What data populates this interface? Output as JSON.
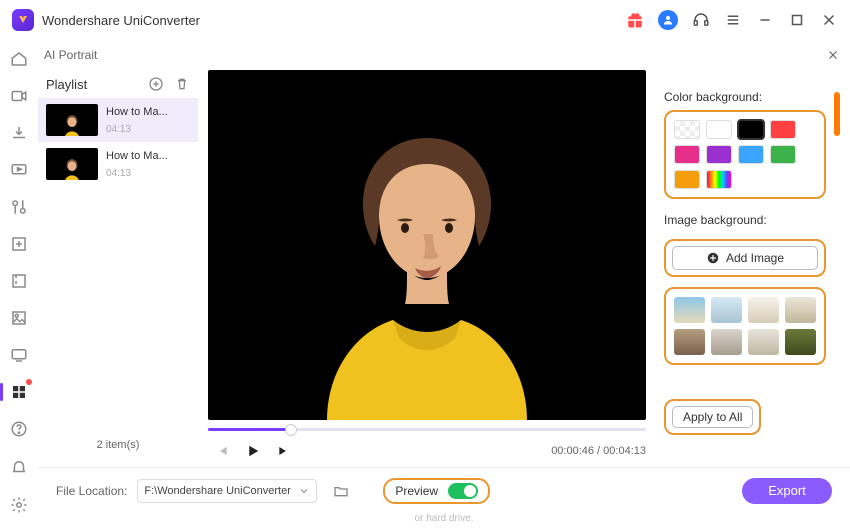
{
  "title": "Wondershare UniConverter",
  "panel": {
    "title": "AI Portrait"
  },
  "playlist": {
    "header": "Playlist",
    "items": [
      {
        "title": "How to Ma...",
        "duration": "04:13"
      },
      {
        "title": "How to Ma...",
        "duration": "04:13"
      }
    ],
    "count_text": "2 item(s)"
  },
  "player": {
    "progress_pct": 19,
    "time_text": "00:00:46 / 00:04:13"
  },
  "backgrounds": {
    "color_label": "Color background:",
    "colors": [
      "transparent",
      "#ffffff",
      "#000000",
      "#ff4040",
      "#e62e8b",
      "#9b30d0",
      "#3aa6ff",
      "#3bb34a",
      "#f59e0b",
      "rainbow"
    ],
    "selected_color_index": 2,
    "image_label": "Image background:",
    "add_image_label": "Add Image"
  },
  "apply_all_label": "Apply to All",
  "footer": {
    "file_location_label": "File Location:",
    "path": "F:\\Wondershare UniConverter",
    "preview_label": "Preview",
    "export_label": "Export",
    "hint1": "or hard drive."
  }
}
